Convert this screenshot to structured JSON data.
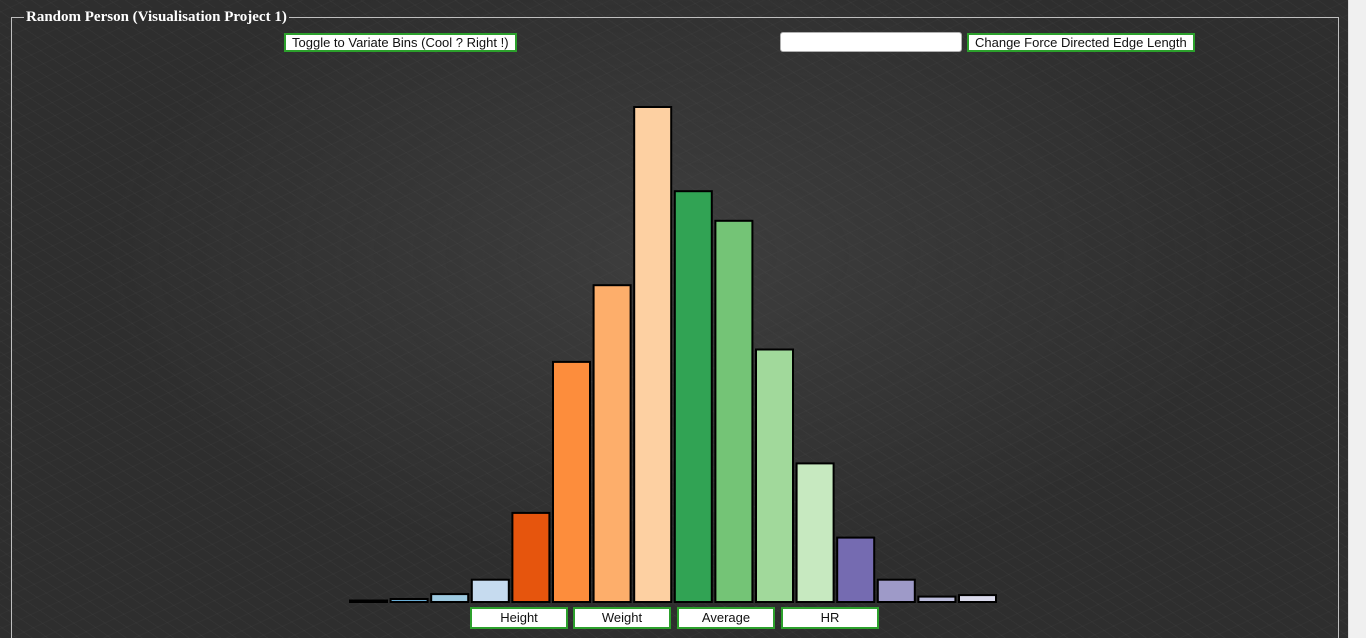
{
  "header": {
    "title": "Random Person (Visualisation Project 1)"
  },
  "controls": {
    "toggle_label": "Toggle to Variate Bins (Cool ? Right !)",
    "edge_input_value": "",
    "edge_button_label": "Change Force Directed Edge Length"
  },
  "variable_buttons": [
    "Height",
    "Weight",
    "Average",
    "HR"
  ],
  "chart_data": {
    "type": "bar",
    "title": "",
    "xlabel": "",
    "ylabel": "",
    "grid": false,
    "ylim": [
      0,
      100
    ],
    "values": [
      0.3,
      0.6,
      1.6,
      4.5,
      18,
      48.5,
      64,
      100,
      83,
      77,
      51,
      28,
      13,
      4.5,
      1.1,
      1.4
    ],
    "colors": [
      "#3182bd",
      "#6baed6",
      "#9ecae1",
      "#c6dbef",
      "#e6550d",
      "#fd8d3c",
      "#fdae6b",
      "#fdd0a2",
      "#31a354",
      "#74c476",
      "#a1d99b",
      "#c7e9c0",
      "#756bb1",
      "#9e9ac8",
      "#bcbddc",
      "#dadaeb"
    ]
  }
}
